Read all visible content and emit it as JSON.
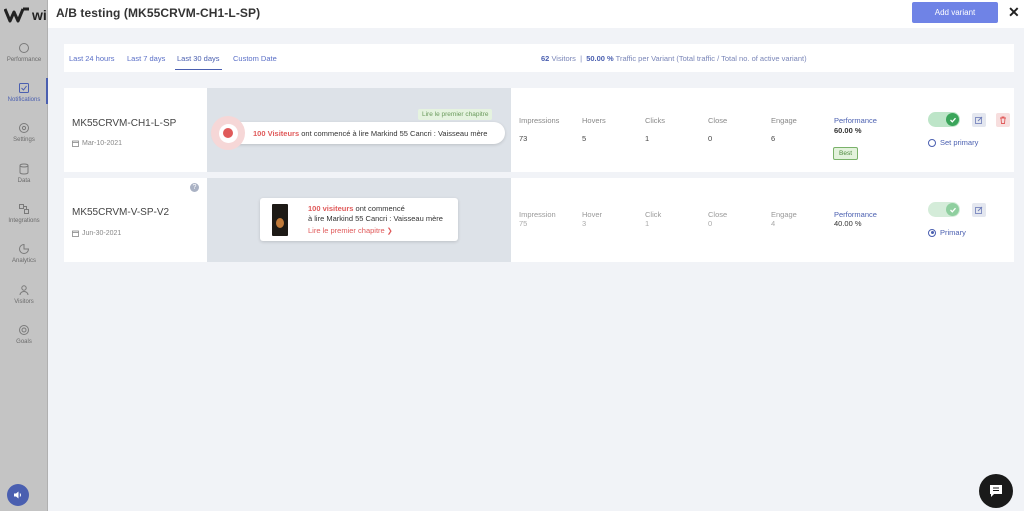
{
  "app": {
    "logo_text": "wi"
  },
  "sidebar": {
    "items": [
      {
        "label": "Performance",
        "icon": "performance-icon"
      },
      {
        "label": "Notifications",
        "icon": "bell-icon",
        "active": true
      },
      {
        "label": "Settings",
        "icon": "gear-icon"
      },
      {
        "label": "Data",
        "icon": "database-icon"
      },
      {
        "label": "Integrations",
        "icon": "integrations-icon"
      },
      {
        "label": "Analytics",
        "icon": "chart-icon"
      },
      {
        "label": "Visitors",
        "icon": "users-icon"
      },
      {
        "label": "Goals",
        "icon": "target-icon"
      }
    ]
  },
  "modal": {
    "title": "A/B testing (MK55CRVM-CH1-L-SP)",
    "add_variant_label": "Add variant",
    "close_label": "✕"
  },
  "filters": {
    "tabs": [
      "Last 24 hours",
      "Last 7 days",
      "Last 30 days",
      "Custom Date"
    ],
    "active_tab": "Last 30 days"
  },
  "stats": {
    "visitors": "62",
    "visitors_label": "Visitors",
    "separator": "|",
    "traffic": "50.00 %",
    "traffic_label": "Traffic per Variant (Total traffic / Total no. of active variant)"
  },
  "variants": [
    {
      "name": "MK55CRVM-CH1-L-SP",
      "date": "Mar-10-2021",
      "preview": {
        "cta_badge": "Lire le premier chapitre",
        "highlight": "100 Visiteurs",
        "text": "ont commencé à lire Markind 55 Cancri : Vaisseau mère"
      },
      "metrics": [
        {
          "label": "Impressions",
          "value": "73"
        },
        {
          "label": "Hovers",
          "value": "5"
        },
        {
          "label": "Clicks",
          "value": "1"
        },
        {
          "label": "Close",
          "value": "0"
        },
        {
          "label": "Engage",
          "value": "6"
        }
      ],
      "performance_label": "Performance",
      "performance_value": "60.00 %",
      "badge": "Best",
      "primary_label": "Set primary",
      "is_primary": false,
      "enabled": true
    },
    {
      "name": "MK55CRVM-V-SP-V2",
      "date": "Jun-30-2021",
      "help": "?",
      "preview": {
        "highlight": "100 visiteurs",
        "text_line1": "ont commencé",
        "text_line2": "à lire Markind 55 Cancri : Vaisseau mère",
        "cta": "Lire le premier chapitre",
        "cta_arrow": "❯"
      },
      "metrics": [
        {
          "label": "Impression",
          "value": "75"
        },
        {
          "label": "Hover",
          "value": "3"
        },
        {
          "label": "Click",
          "value": "1"
        },
        {
          "label": "Close",
          "value": "0"
        },
        {
          "label": "Engage",
          "value": "4"
        }
      ],
      "performance_label": "Performance",
      "performance_value": "40.00 %",
      "primary_label": "Primary",
      "is_primary": true,
      "enabled": true
    }
  ],
  "colors": {
    "accent": "#4a5fb0",
    "button": "#6f83e6",
    "highlight": "#e05a5a",
    "toggle_on": "#3aa55a"
  }
}
